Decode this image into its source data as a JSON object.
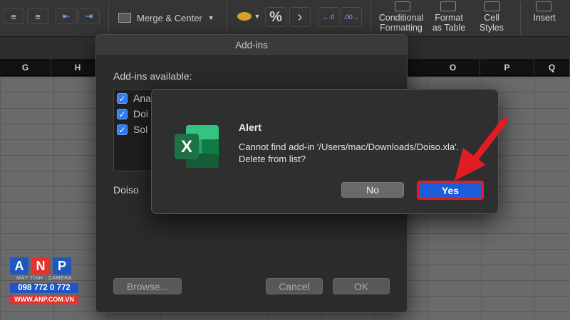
{
  "ribbon": {
    "merge_center_label": "Merge & Center",
    "percent_symbol": "%",
    "thousands_symbol": "›",
    "styles": [
      {
        "label": "Conditional Formatting"
      },
      {
        "label": "Format as Table"
      },
      {
        "label": "Cell Styles"
      }
    ],
    "insert_label": "Insert"
  },
  "columns": [
    "G",
    "H",
    "O",
    "P",
    "Q"
  ],
  "addins_dialog": {
    "title": "Add-ins",
    "available_label": "Add-ins available:",
    "items": [
      {
        "label": "Ana",
        "checked": true
      },
      {
        "label": "Doi",
        "checked": true
      },
      {
        "label": "Sol",
        "checked": true
      }
    ],
    "description": "Doiso",
    "browse_label": "Browse...",
    "cancel_label": "Cancel",
    "ok_label": "OK"
  },
  "alert": {
    "title": "Alert",
    "message_line1": "Cannot find add-in '/Users/mac/Downloads/Doiso.xla'.",
    "message_line2": "Delete from list?",
    "no_label": "No",
    "yes_label": "Yes",
    "icon": "excel-icon",
    "icon_letter": "X"
  },
  "logo": {
    "letters": [
      "A",
      "N",
      "P"
    ],
    "tagline": "MÁY TÍNH · CAMERA",
    "phone": "098 772 0 772",
    "website": "WWW.ANP.COM.VN"
  },
  "colors": {
    "accent_blue": "#1c5ddb",
    "highlight_red": "#e11d24",
    "excel_green": "#1e7145"
  }
}
